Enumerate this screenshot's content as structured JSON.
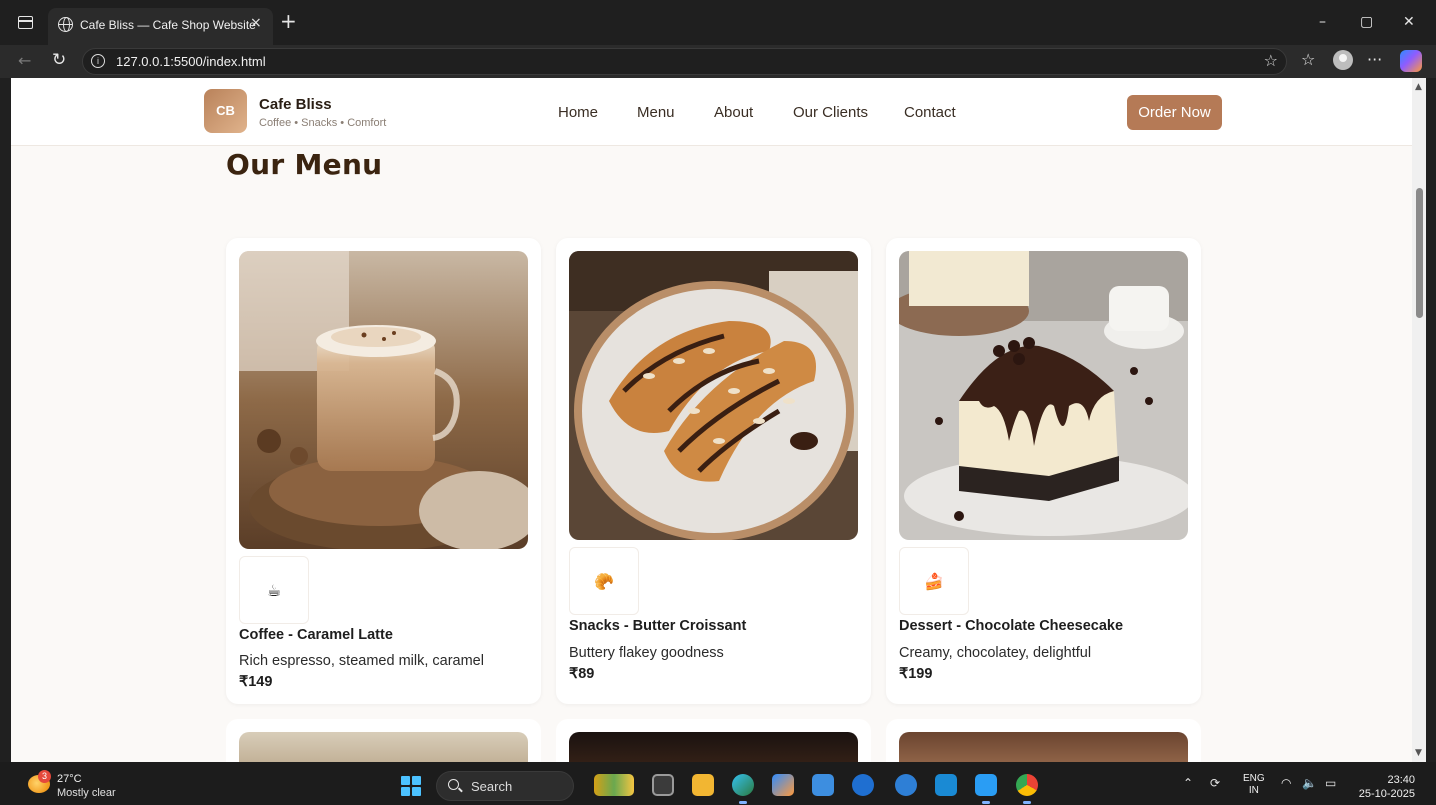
{
  "browser": {
    "tab_title": "Cafe Bliss — Cafe Shop Website",
    "tab_close": "×",
    "new_tab": "+",
    "url": "127.0.0.1:5500/index.html",
    "window_controls": {
      "minimize": "–",
      "maximize": "▢",
      "close": "✕"
    }
  },
  "site": {
    "logo_initials": "CB",
    "brand_name": "Cafe Bliss",
    "brand_tagline": "Coffee • Snacks • Comfort",
    "nav": [
      "Home",
      "Menu",
      "About",
      "Our Clients",
      "Contact"
    ],
    "cta": "Order Now"
  },
  "menu": {
    "heading": "Our Menu",
    "items": [
      {
        "icon": "☕",
        "title": "Coffee - Caramel Latte",
        "description": "Rich espresso, steamed milk, caramel",
        "price": "₹149"
      },
      {
        "icon": "🥐",
        "title": "Snacks - Butter Croissant",
        "description": "Buttery flakey goodness",
        "price": "₹89"
      },
      {
        "icon": "🍰",
        "title": "Dessert - Chocolate Cheesecake",
        "description": "Creamy, chocolatey, delightful",
        "price": "₹199"
      }
    ]
  },
  "taskbar": {
    "weather_badge": "3",
    "weather_temp": "27°C",
    "weather_desc": "Mostly clear",
    "search_label": "Search",
    "lang_top": "ENG",
    "lang_bottom": "IN",
    "time": "23:40",
    "date": "25-10-2025"
  },
  "colors": {
    "accent": "#b57a56",
    "heading": "#3b2410",
    "page_bg": "#fbf9f7"
  }
}
